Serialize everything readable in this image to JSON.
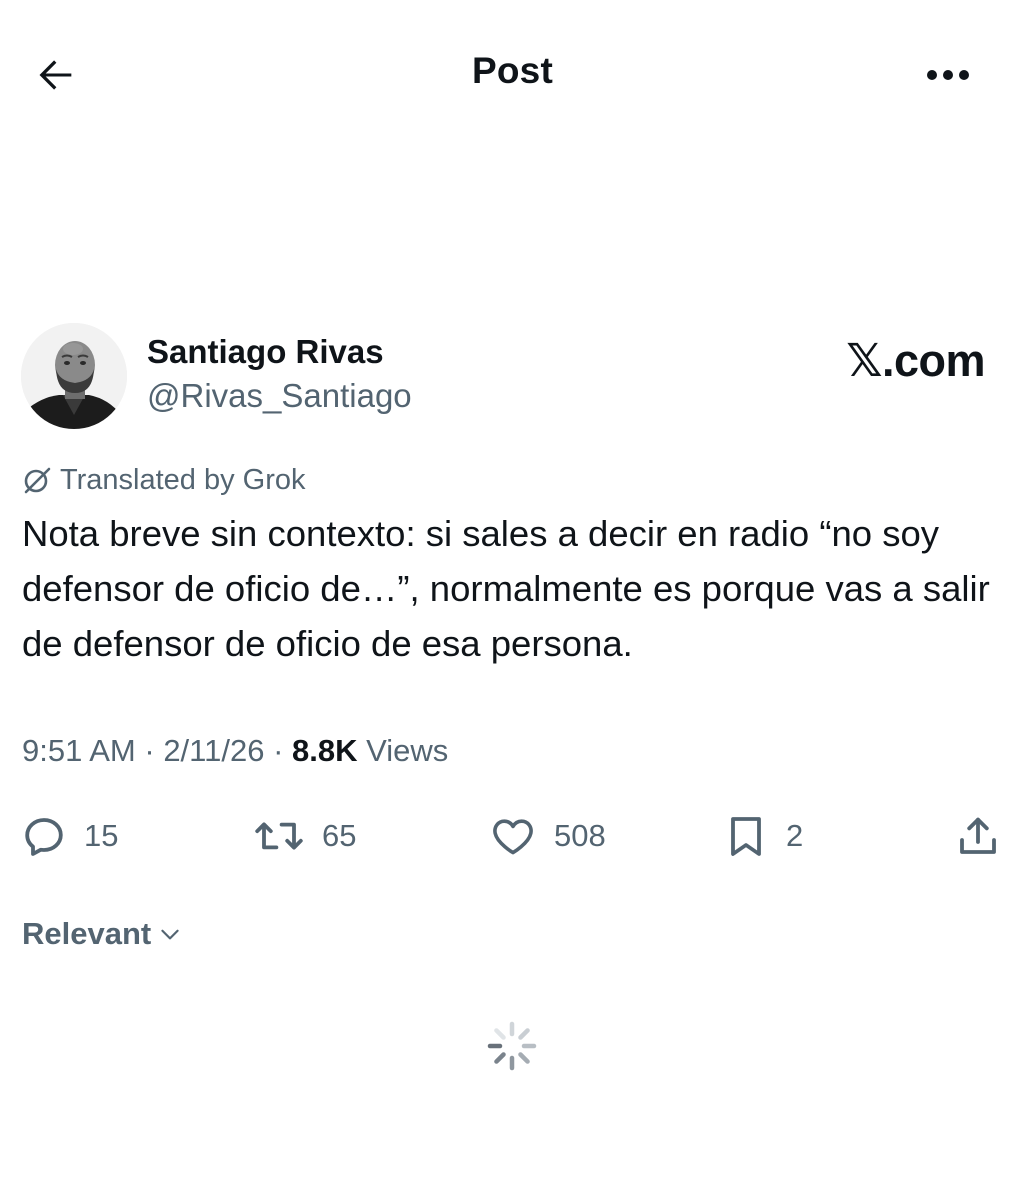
{
  "header": {
    "title": "Post",
    "back_icon": "arrow-left-icon",
    "more_icon": "more-horizontal-icon"
  },
  "author": {
    "name": "Santiago Rivas",
    "handle": "@Rivas_Santiago",
    "avatar": "avatar-photo"
  },
  "watermark": "𝕏.com",
  "translation": {
    "icon": "grok-icon",
    "label": "Translated by Grok"
  },
  "post": {
    "text": "Nota breve sin contexto: si sales a decir en radio “no soy defensor de oficio de…”, normalmente es porque vas a salir de defensor de oficio de esa persona.",
    "time": "9:51 AM",
    "date": "2/11/26",
    "views_count": "8.8K",
    "views_label": "Views"
  },
  "actions": {
    "replies": "15",
    "reposts": "65",
    "likes": "508",
    "bookmarks": "2",
    "reply_icon": "reply-icon",
    "repost_icon": "repost-icon",
    "like_icon": "heart-icon",
    "bookmark_icon": "bookmark-icon",
    "share_icon": "share-icon"
  },
  "replies_filter": {
    "label": "Relevant"
  },
  "colors": {
    "text_primary": "#0f1419",
    "text_secondary": "#536471",
    "background": "#ffffff"
  }
}
